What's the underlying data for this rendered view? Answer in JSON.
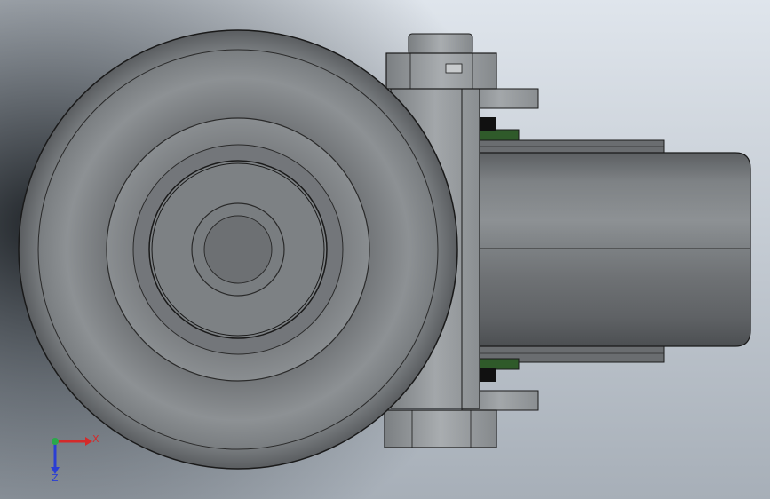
{
  "view": {
    "background_top": "#dde3ea",
    "background_bottom": "#9aa2ab",
    "shadow_color": "#1e2328"
  },
  "model": {
    "metal_color": "#8f9396",
    "tire_color": "#6f7275",
    "seal_color": "#2f5a2a",
    "outline_color": "#1a1a1a"
  },
  "triad": {
    "x_label": "X",
    "z_label": "Z",
    "x_color": "#d42a2a",
    "y_color": "#2aa84a",
    "z_color": "#2a3ed4"
  }
}
